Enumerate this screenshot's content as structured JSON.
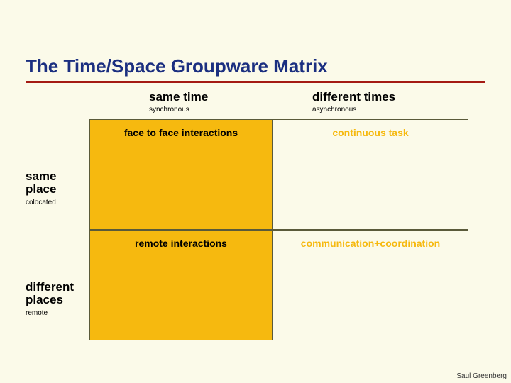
{
  "title": "The Time/Space Groupware Matrix",
  "columns": [
    {
      "main": "same time",
      "sub": "synchronous"
    },
    {
      "main": "different times",
      "sub": "asynchronous"
    }
  ],
  "rows": [
    {
      "main_line1": "same",
      "main_line2": "place",
      "sub": "colocated"
    },
    {
      "main_line1": "different",
      "main_line2": "places",
      "sub": "remote"
    }
  ],
  "cells": {
    "top_left": "face to face interactions",
    "top_right": "continuous task",
    "bottom_left": "remote interactions",
    "bottom_right": "communication+coordination"
  },
  "credit": "Saul Greenberg"
}
